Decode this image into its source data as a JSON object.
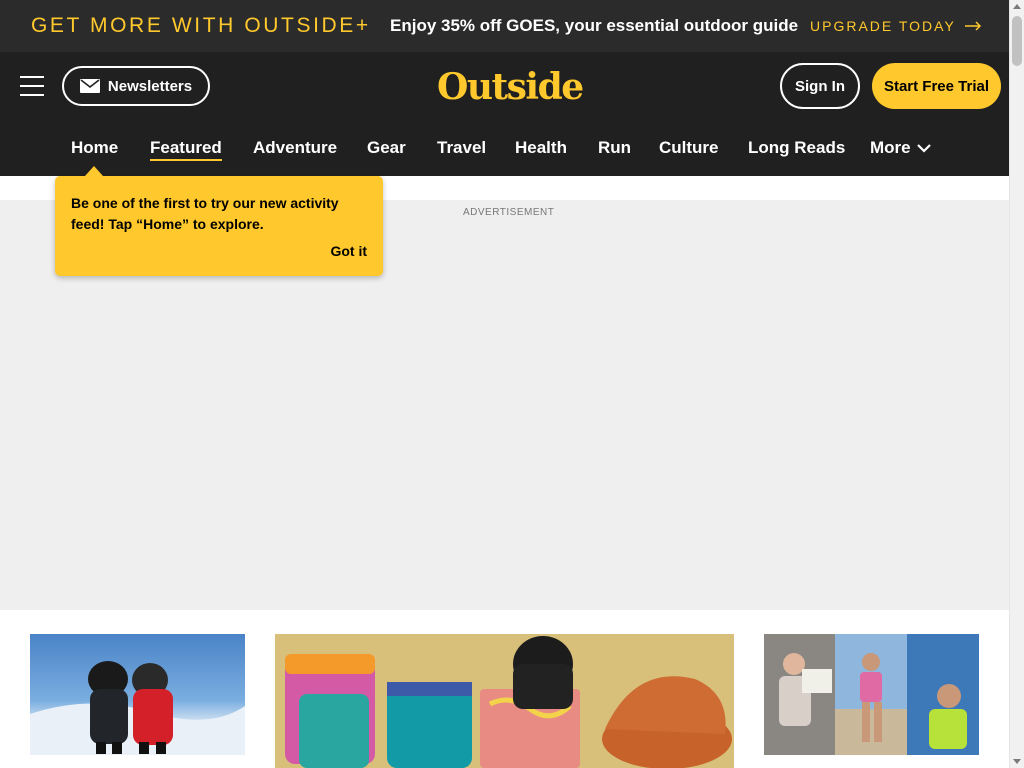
{
  "promo": {
    "left_text": "GET MORE WITH OUTSIDE+",
    "middle_text": "Enjoy 35% off GOES, your essential outdoor guide",
    "cta": "UPGRADE TODAY"
  },
  "header": {
    "newsletters_label": "Newsletters",
    "logo": "Outside",
    "signin_label": "Sign In",
    "trial_label": "Start Free Trial"
  },
  "nav": {
    "items": [
      "Home",
      "Featured",
      "Adventure",
      "Gear",
      "Travel",
      "Health",
      "Run",
      "Culture",
      "Long Reads"
    ],
    "more_label": "More",
    "active": "Featured"
  },
  "tooltip": {
    "text": "Be one of the first to try our new activity feed! Tap “Home” to explore.",
    "button": "Got it"
  },
  "ad": {
    "label": "ADVERTISEMENT"
  },
  "colors": {
    "accent": "#ffc82c",
    "header_bg": "#202020",
    "promo_bg": "#2b2b2b",
    "ad_bg": "#efefef"
  },
  "icons": [
    "menu-icon",
    "envelope-icon",
    "arrow-right-icon",
    "chevron-down-icon"
  ]
}
